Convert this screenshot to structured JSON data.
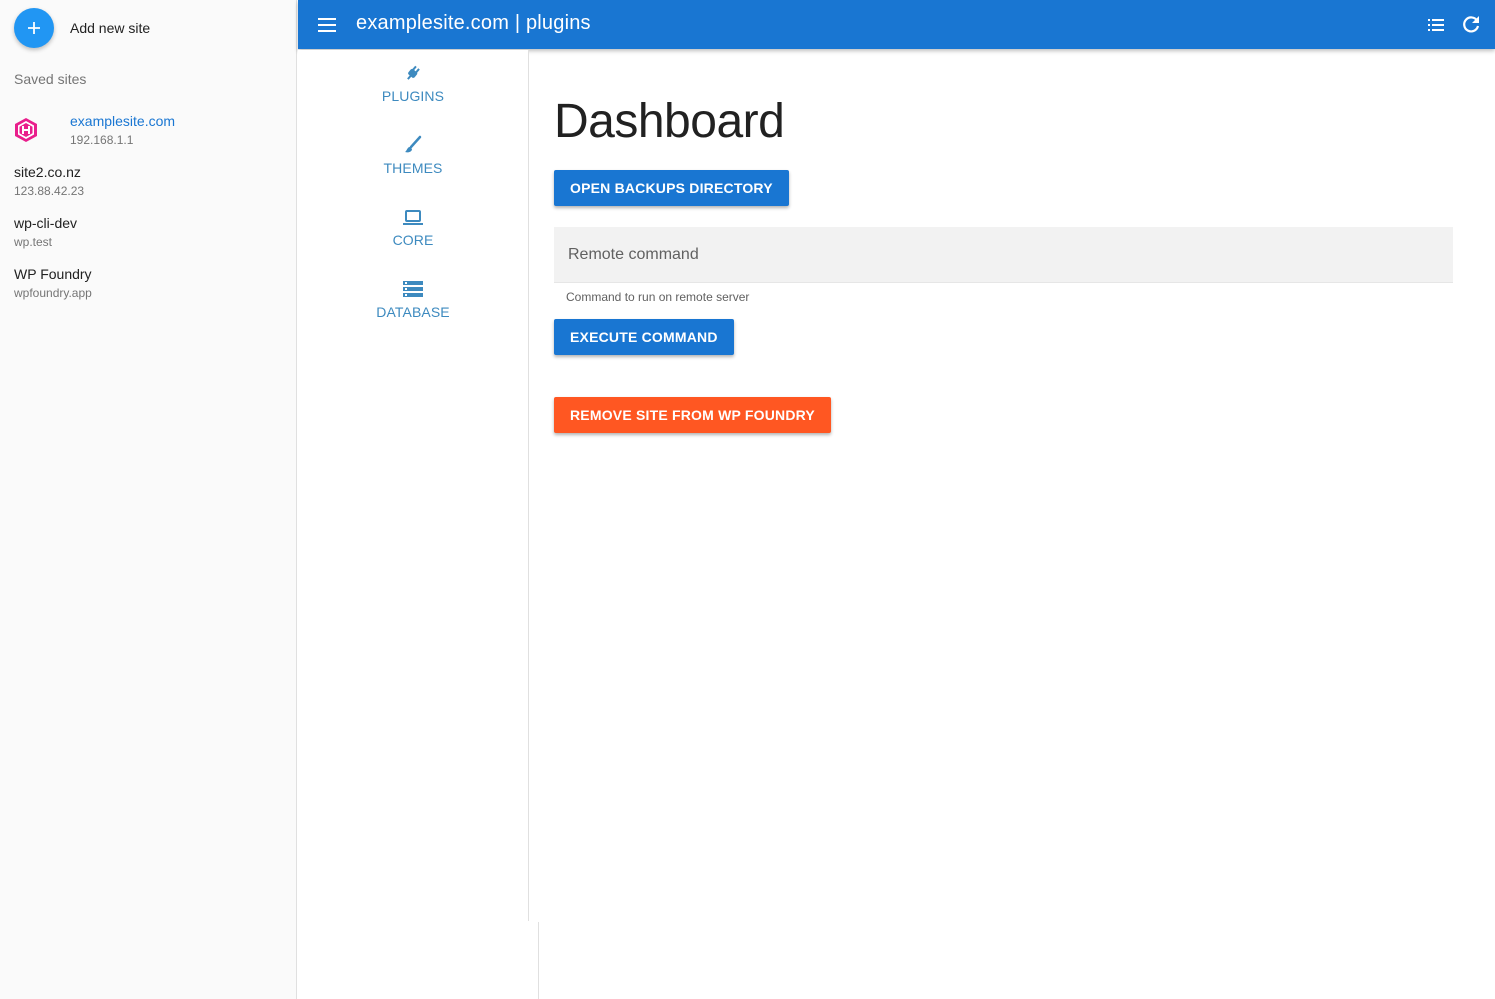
{
  "drawer": {
    "add_label": "Add new site",
    "saved_header": "Saved sites",
    "sites": [
      {
        "name": "examplesite.com",
        "host": "192.168.1.1",
        "active": true
      },
      {
        "name": "site2.co.nz",
        "host": "123.88.42.23"
      },
      {
        "name": "wp-cli-dev",
        "host": "wp.test"
      },
      {
        "name": "WP Foundry",
        "host": "wpfoundry.app"
      }
    ]
  },
  "topbar": {
    "title": "examplesite.com | plugins",
    "icons": [
      "menu-icon",
      "list-icon",
      "refresh-icon"
    ]
  },
  "sectionnav": {
    "items": [
      {
        "label": "PLUGINS",
        "icon": "plug-icon"
      },
      {
        "label": "THEMES",
        "icon": "brush-icon"
      },
      {
        "label": "CORE",
        "icon": "laptop-icon"
      },
      {
        "label": "DATABASE",
        "icon": "storage-icon"
      }
    ]
  },
  "main": {
    "title": "Dashboard",
    "open_backups_label": "OPEN BACKUPS DIRECTORY",
    "remote_command": {
      "placeholder": "Remote command",
      "value": "",
      "hint": "Command to run on remote server"
    },
    "execute_label": "EXECUTE COMMAND",
    "remove_label": "REMOVE SITE FROM WP FOUNDRY"
  },
  "colors": {
    "primary": "#1976d2",
    "fab": "#2196f3",
    "danger": "#ff5722",
    "nav_text": "#3d8abf",
    "logo": "#e91e8c"
  }
}
